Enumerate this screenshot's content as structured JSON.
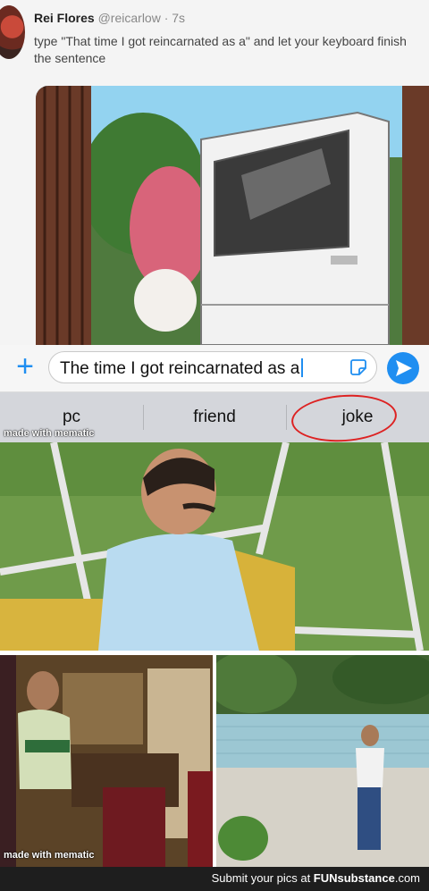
{
  "tweet": {
    "name": "Rei Flores",
    "handle": "@reicarlow · 7s",
    "text": "type \"That time I got reincarnated as a\" and let your keyboard finish the sentence"
  },
  "message_bar": {
    "input_value": "The time I got reincarnated as a"
  },
  "predictive_bar": {
    "suggestions": [
      "pc",
      "friend",
      "joke"
    ]
  },
  "watermark": "made with mematic",
  "footer": {
    "prefix": "Submit your pics at ",
    "brand": "FUNsubstance",
    "suffix": ".com"
  },
  "colors": {
    "accent": "#1f8ef1",
    "keyboard_bg": "#d4d6db",
    "highlight_circle": "#dd2222"
  }
}
